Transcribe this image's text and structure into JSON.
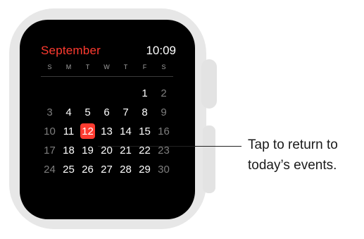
{
  "calendar": {
    "month": "September",
    "time": "10:09",
    "weekdays": [
      "S",
      "M",
      "T",
      "W",
      "T",
      "F",
      "S"
    ],
    "weeks": [
      [
        "",
        "",
        "",
        "",
        "",
        "1",
        "2"
      ],
      [
        "3",
        "4",
        "5",
        "6",
        "7",
        "8",
        "9"
      ],
      [
        "10",
        "11",
        "12",
        "13",
        "14",
        "15",
        "16"
      ],
      [
        "17",
        "18",
        "19",
        "20",
        "21",
        "22",
        "23"
      ],
      [
        "24",
        "25",
        "26",
        "27",
        "28",
        "29",
        "30"
      ]
    ],
    "today": "12"
  },
  "callout": {
    "line1": "Tap to return to",
    "line2": "today’s events."
  },
  "colors": {
    "accent": "#ff3b30",
    "screen": "#000000",
    "case": "#e7e7e7"
  }
}
